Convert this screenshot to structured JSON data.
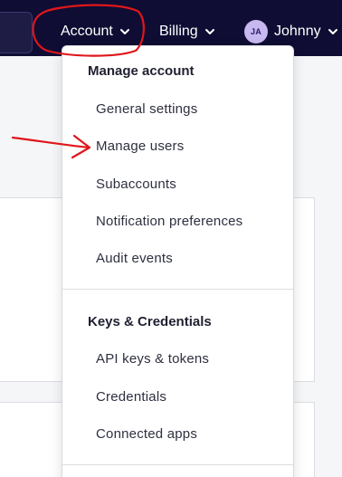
{
  "nav": {
    "account_label": "Account",
    "billing_label": "Billing",
    "user": {
      "initials": "JA",
      "name": "Johnny"
    }
  },
  "menu": {
    "sections": [
      {
        "heading": "Manage account",
        "items": [
          "General settings",
          "Manage users",
          "Subaccounts",
          "Notification preferences",
          "Audit events"
        ]
      },
      {
        "heading": "Keys & Credentials",
        "items": [
          "API keys & tokens",
          "Credentials",
          "Connected apps"
        ]
      }
    ]
  },
  "colors": {
    "nav_bg": "#0f0d33",
    "annotation": "#e0161b",
    "avatar_bg": "#c7b8f0"
  }
}
